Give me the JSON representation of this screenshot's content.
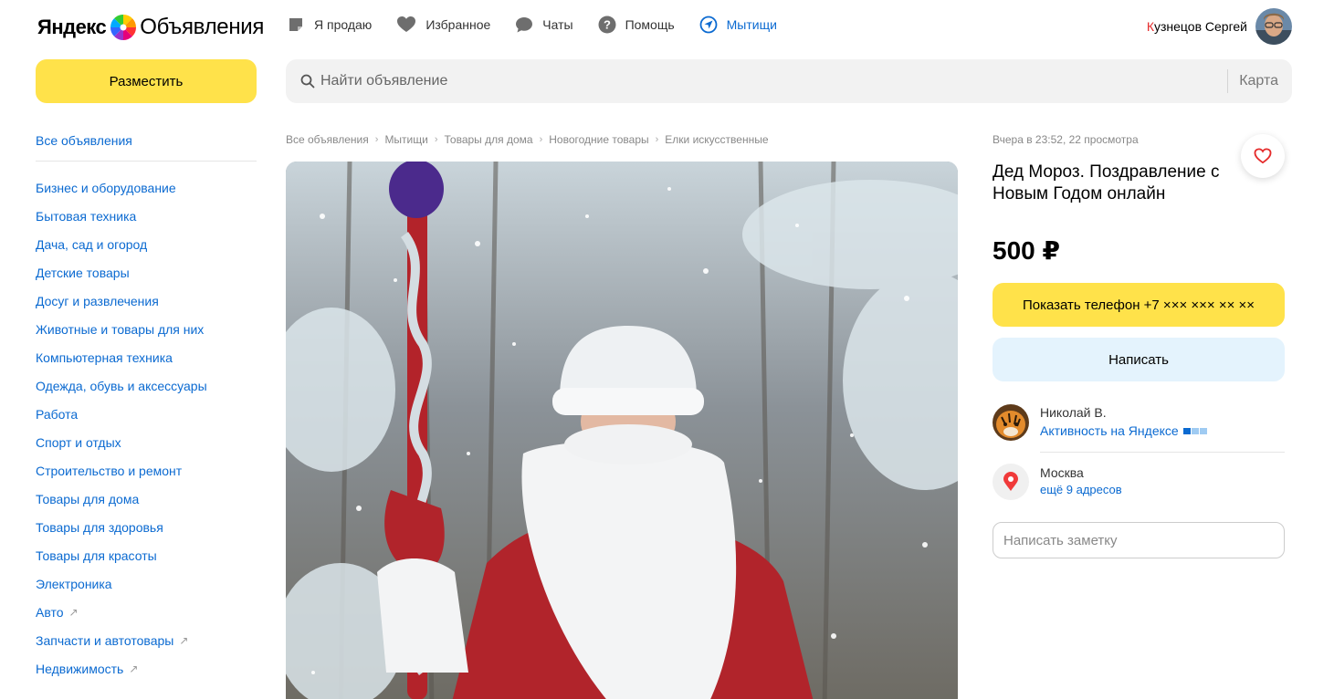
{
  "logo": {
    "brand": "Яндекс",
    "product": "Объявления"
  },
  "nav": {
    "items": [
      {
        "label": "Я продаю",
        "icon": "sell-icon"
      },
      {
        "label": "Избранное",
        "icon": "heart-icon"
      },
      {
        "label": "Чаты",
        "icon": "chat-icon"
      },
      {
        "label": "Помощь",
        "icon": "help-icon"
      },
      {
        "label": "Мытищи",
        "icon": "location-arrow-icon"
      }
    ]
  },
  "user": {
    "first_letter": "К",
    "name_rest": "узнецов Сергей"
  },
  "place_button": "Разместить",
  "search": {
    "placeholder": "Найти объявление",
    "map_label": "Карта"
  },
  "sidebar": {
    "all_label": "Все объявления",
    "categories": [
      {
        "label": "Бизнес и оборудование",
        "external": false
      },
      {
        "label": "Бытовая техника",
        "external": false
      },
      {
        "label": "Дача, сад и огород",
        "external": false
      },
      {
        "label": "Детские товары",
        "external": false
      },
      {
        "label": "Досуг и развлечения",
        "external": false
      },
      {
        "label": "Животные и товары для них",
        "external": false
      },
      {
        "label": "Компьютерная техника",
        "external": false
      },
      {
        "label": "Одежда, обувь и аксессуары",
        "external": false
      },
      {
        "label": "Работа",
        "external": false
      },
      {
        "label": "Спорт и отдых",
        "external": false
      },
      {
        "label": "Строительство и ремонт",
        "external": false
      },
      {
        "label": "Товары для дома",
        "external": false
      },
      {
        "label": "Товары для здоровья",
        "external": false
      },
      {
        "label": "Товары для красоты",
        "external": false
      },
      {
        "label": "Электроника",
        "external": false
      },
      {
        "label": "Авто",
        "external": true
      },
      {
        "label": "Запчасти и автотовары",
        "external": true
      },
      {
        "label": "Недвижимость",
        "external": true
      }
    ]
  },
  "breadcrumbs": [
    "Все объявления",
    "Мытищи",
    "Товары для дома",
    "Новогодние товары",
    "Елки искусственные"
  ],
  "listing": {
    "meta": "Вчера в 23:52, 22 просмотра",
    "title": "Дед Мороз. Поздравление с Новым Годом онлайн",
    "price": "500 ₽",
    "phone_button": "Показать телефон +7 ××× ××× ×× ××",
    "write_button": "Написать",
    "seller": {
      "name": "Николай В.",
      "activity": "Активность на Яндексе"
    },
    "location": {
      "city": "Москва",
      "more": "ещё 9 адресов"
    },
    "note_placeholder": "Написать заметку"
  },
  "colors": {
    "accent_yellow": "#ffe24a",
    "link_blue": "#0b6ad1",
    "write_bg": "#e4f3fd"
  }
}
